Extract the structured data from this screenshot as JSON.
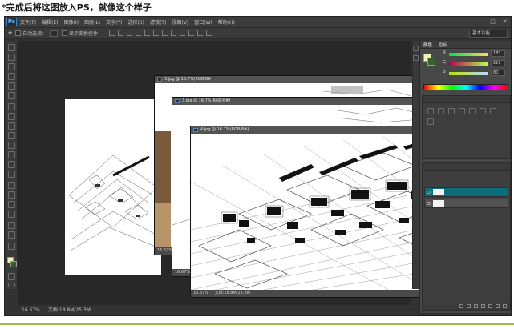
{
  "caption": "*完成后将这图放入PS，就像这个样子",
  "app": {
    "logo": "Ps",
    "menu": [
      "文件(F)",
      "编辑(E)",
      "图像(I)",
      "图层(L)",
      "文字(Y)",
      "选择(S)",
      "滤镜(T)",
      "视图(V)",
      "窗口(W)",
      "帮助(H)"
    ],
    "window_buttons": [
      "—",
      "□",
      "✕"
    ]
  },
  "options_bar": {
    "auto_select_label": "自动选择：",
    "transform_label": "显示变换控件",
    "workspace": "基本功能"
  },
  "documents": [
    {
      "id": "doc-back",
      "title": "5.jpg @ 16.7%(RGB/8#)",
      "zoom": "16.67%",
      "file_info": ""
    },
    {
      "id": "doc-mid",
      "title": "3.jpg @ 16.7%(RGB/8#)",
      "zoom": "16.67%",
      "file_info": ""
    },
    {
      "id": "doc-front",
      "title": "4.jpg @ 16.7%(RGB/8#)",
      "zoom": "16.67%",
      "file_info": "文档:18.8M/25.3M",
      "controls": [
        "—",
        "□",
        "✕"
      ]
    }
  ],
  "status_bar": {
    "zoom": "16.67%",
    "file_info": "文档:18.8M/25.3M"
  },
  "panels": {
    "color_tabs": [
      "颜色",
      "色板"
    ],
    "color_values": [
      {
        "channel": "R",
        "value": "183"
      },
      {
        "channel": "G",
        "value": "221"
      },
      {
        "channel": "B",
        "value": "80"
      }
    ],
    "colors": {
      "foreground": "#f2f2b6",
      "background": "#3a5f2f",
      "accent_layer": "#0b6c7a"
    }
  }
}
